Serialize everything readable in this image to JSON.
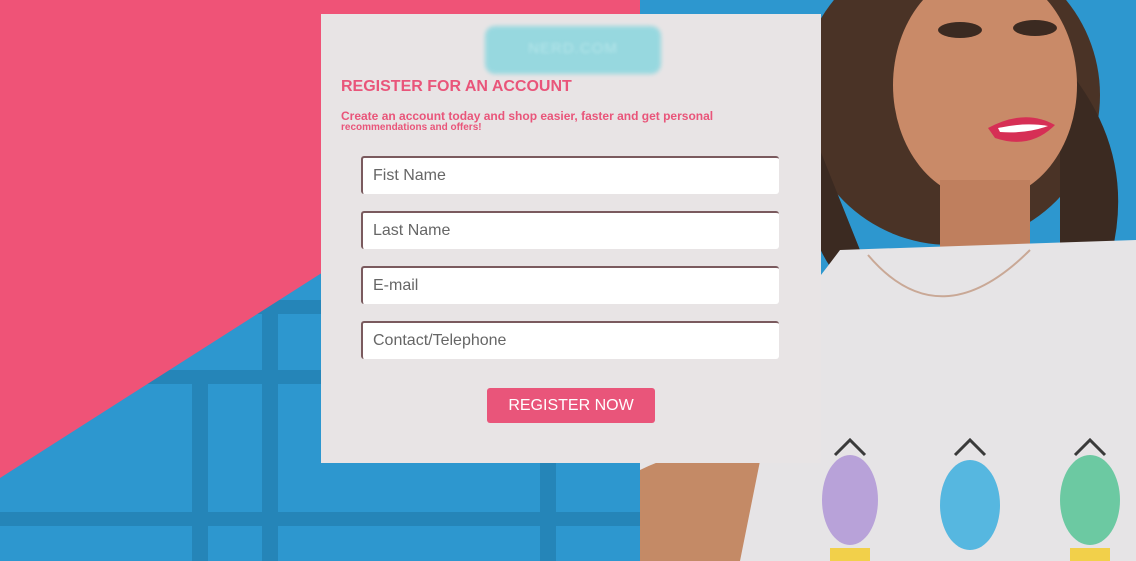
{
  "logo": {
    "text": "NERD.COM"
  },
  "form": {
    "title": "REGISTER FOR AN ACCOUNT",
    "subtitle_line1": "Create an account today and shop easier, faster and get personal",
    "subtitle_line2": "recommendations and offers!",
    "fields": [
      {
        "placeholder": "Fist Name",
        "value": ""
      },
      {
        "placeholder": "Last Name",
        "value": ""
      },
      {
        "placeholder": "E-mail",
        "value": ""
      },
      {
        "placeholder": "Contact/Telephone",
        "value": ""
      }
    ],
    "submit_label": "REGISTER NOW"
  },
  "colors": {
    "accent_pink": "#e9557a",
    "background_blue": "#2d97cf",
    "card_bg": "#e8e4e5"
  }
}
